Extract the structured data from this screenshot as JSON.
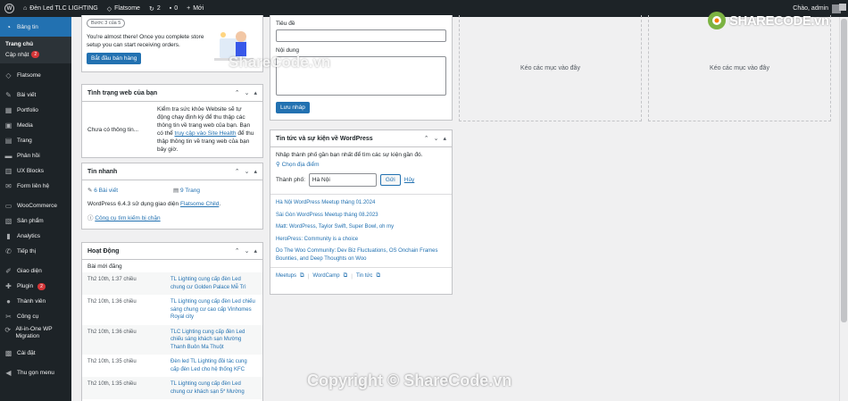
{
  "adminbar": {
    "site_name": "Đèn Led TLC LIGHTING",
    "theme": "Flatsome",
    "updates_count": "2",
    "comments_count": "0",
    "new_label": "Mới",
    "greeting": "Chào, admin"
  },
  "sidebar": {
    "dashboard": "Bảng tin",
    "home": "Trang chủ",
    "updates": "Cập nhật",
    "updates_badge": "2",
    "items": [
      {
        "label": "Flatsome",
        "icon": "flatsome-icon"
      },
      {
        "label": "Bài viết",
        "icon": "pin-icon"
      },
      {
        "label": "Portfolio",
        "icon": "portfolio-icon"
      },
      {
        "label": "Media",
        "icon": "media-icon"
      },
      {
        "label": "Trang",
        "icon": "page-icon"
      },
      {
        "label": "Phản hồi",
        "icon": "comment-icon"
      },
      {
        "label": "UX Blocks",
        "icon": "blocks-icon"
      },
      {
        "label": "Form liên hệ",
        "icon": "form-icon"
      },
      {
        "label": "WooCommerce",
        "icon": "woo-icon"
      },
      {
        "label": "Sản phẩm",
        "icon": "product-icon"
      },
      {
        "label": "Analytics",
        "icon": "analytics-icon"
      },
      {
        "label": "Tiếp thị",
        "icon": "marketing-icon"
      },
      {
        "label": "Giao diện",
        "icon": "appearance-icon"
      },
      {
        "label": "Plugin",
        "icon": "plugin-icon",
        "badge": "2"
      },
      {
        "label": "Thành viên",
        "icon": "users-icon"
      },
      {
        "label": "Công cụ",
        "icon": "tools-icon"
      },
      {
        "label": "All-in-One WP Migration",
        "icon": "migration-icon"
      },
      {
        "label": "Cài đặt",
        "icon": "settings-icon"
      },
      {
        "label": "Thu gọn menu",
        "icon": "collapse-icon"
      }
    ]
  },
  "setup": {
    "step": "Bước 3 của 5",
    "text": "You're almost there! Once you complete store setup you can start receiving orders.",
    "button": "Bắt đầu bán hàng"
  },
  "site_health": {
    "title": "Tình trạng web của bạn",
    "status": "Chưa có thông tin...",
    "text_before": "Kiểm tra sức khỏe Website sẽ tự động chạy định kỳ để thu thập các thông tin về trang web của bạn. Bạn có thể ",
    "link": "truy cập vào Site Health",
    "text_after": " để thu thập thông tin về trang web của bạn bây giờ."
  },
  "glance": {
    "title": "Tin nhanh",
    "posts": "6 Bài viết",
    "pages": "9 Trang",
    "wp_version_text": "WordPress 6.4.3 sử dụng giao diện ",
    "theme_link": "Flatsome Child",
    "search_engine": "Công cụ tìm kiếm bị chặn"
  },
  "activity": {
    "title": "Hoạt Động",
    "subtitle": "Bài mới đăng",
    "rows": [
      {
        "date": "Th2 10th, 1:37 chiều",
        "title": "TL Lighting cung cấp đèn Led chung cư Golden Palace Mễ Trì"
      },
      {
        "date": "Th2 10th, 1:36 chiều",
        "title": "TL Lighting cung cấp đèn Led chiếu sáng chung cư cao cấp Vinhomes Royal city"
      },
      {
        "date": "Th2 10th, 1:36 chiều",
        "title": "TLC Lighting cung cấp đèn Led chiếu sáng khách sạn Mường Thanh Buôn Ma Thuột"
      },
      {
        "date": "Th2 10th, 1:35 chiều",
        "title": "Đèn led TL Lighting đồi tác cung cấp đèn Led cho hệ thống KFC"
      },
      {
        "date": "Th2 10th, 1:35 chiều",
        "title": "TL Lighting cung cấp đèn Led chung cư khách sạn 5* Mường"
      }
    ]
  },
  "quick_draft": {
    "title_label": "Tiêu đề",
    "content_label": "Nội dung",
    "button": "Lưu nháp"
  },
  "events": {
    "title": "Tin tức và sự kiện về WordPress",
    "intro": "Nhập thành phố gần bạn nhất để tìm các sự kiện gần đó.",
    "choose_location": "Chọn địa điểm",
    "city_label": "Thành phố:",
    "city_value": "Hà Nội",
    "submit": "Gửi",
    "cancel": "Hủy",
    "news": [
      "Hà Nội WordPress Meetup tháng 01.2024",
      "Sài Gòn WordPress Meetup tháng 08.2023",
      "Matt: WordPress, Taylor Swift, Super Bowl, oh my",
      "HeroPress: Community is a choice",
      "Do The Woo Community: Dev Biz Fluctuations, OS Onchain Frames Bounties, and Deep Thoughts on Woo"
    ],
    "footer": [
      "Meetups",
      "WordCamp",
      "Tin tức"
    ]
  },
  "dropzones": {
    "left": "Kéo các mục vào đây",
    "right": "Kéo các mục vào đây"
  },
  "watermarks": {
    "logo": "SHARECODE.vn",
    "center": "ShareCode.vn",
    "bottom": "Copyright © ShareCode.vn"
  }
}
